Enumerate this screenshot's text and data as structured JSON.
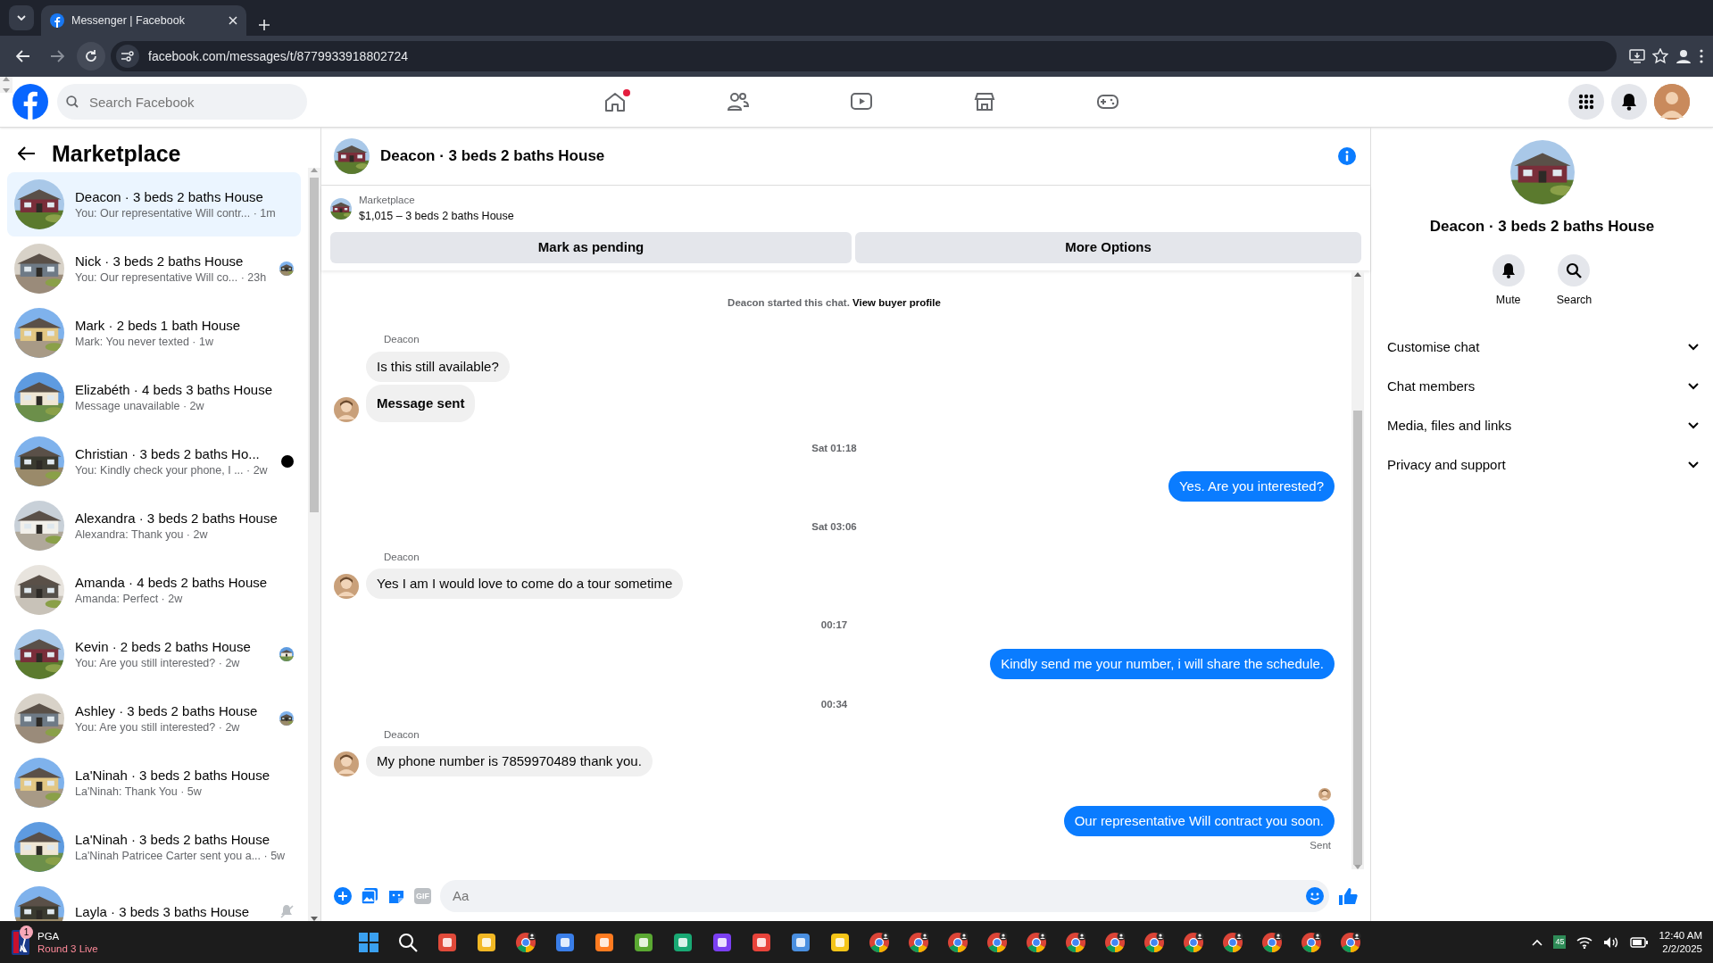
{
  "browser": {
    "tab_title": "Messenger | Facebook",
    "url": "facebook.com/messages/t/8779933918802724"
  },
  "header": {
    "search_placeholder": "Search Facebook",
    "nav": [
      {
        "kind": "home",
        "dot": true
      },
      {
        "kind": "friends",
        "dot": false
      },
      {
        "kind": "video",
        "dot": false
      },
      {
        "kind": "marketplace",
        "dot": false
      },
      {
        "kind": "gaming",
        "dot": false
      }
    ]
  },
  "sidebar": {
    "title": "Marketplace",
    "conversations": [
      {
        "title": "Deacon · 3 beds 2 baths House",
        "preview": "You: Our representative Will contr...",
        "time": "· 1m",
        "selected": true
      },
      {
        "title": "Nick · 3 beds 2 baths House",
        "preview": "You: Our representative Will co...",
        "time": "· 23h",
        "selected": false,
        "badge": {
          "kind": "read_avatar"
        }
      },
      {
        "title": "Mark · 2 beds 1 bath House",
        "preview": "Mark: You never texted",
        "time": "· 1w",
        "selected": false
      },
      {
        "title": "Elizabéth · 4 beds 3 baths House",
        "preview": "Message unavailable",
        "time": "· 2w",
        "selected": false
      },
      {
        "title": "Christian · 3 beds 2 baths Ho...",
        "preview": "You: Kindly check your phone, I ...",
        "time": "· 2w",
        "selected": false,
        "badge": {
          "kind": "dot"
        }
      },
      {
        "title": "Alexandra · 3 beds 2 baths House",
        "preview": "Alexandra: Thank you",
        "time": "· 2w",
        "selected": false
      },
      {
        "title": "Amanda · 4 beds 2 baths House",
        "preview": "Amanda: Perfect",
        "time": "· 2w",
        "selected": false
      },
      {
        "title": "Kevin · 2 beds 2 baths House",
        "preview": "You: Are you still interested?",
        "time": "· 2w",
        "selected": false,
        "badge": {
          "kind": "read_avatar"
        }
      },
      {
        "title": "Ashley · 3 beds 2 baths House",
        "preview": "You: Are you still interested?",
        "time": "· 2w",
        "selected": false,
        "badge": {
          "kind": "read_avatar"
        }
      },
      {
        "title": "La'Ninah · 3 beds 2 baths House",
        "preview": "La'Ninah: Thank You",
        "time": "· 5w",
        "selected": false
      },
      {
        "title": "La'Ninah · 3 beds 2 baths House",
        "preview": "La'Ninah Patricee Carter sent you a...",
        "time": "· 5w",
        "selected": false
      },
      {
        "title": "Layla · 3 beds 3 baths House",
        "selected": false,
        "badge": {
          "kind": "muted"
        }
      }
    ]
  },
  "chat": {
    "title": "Deacon · 3 beds 2 baths House",
    "listing_label": "Marketplace",
    "listing": "$1,015 – 3 beds 2 baths House",
    "actions": [
      "Mark as pending",
      "More Options"
    ],
    "messages": [
      {
        "kind": "system",
        "text": "Deacon started this chat.",
        "link": "View buyer profile"
      },
      {
        "kind": "sender",
        "text": "Deacon"
      },
      {
        "kind": "incoming",
        "text": "Is this still available?",
        "bold": false
      },
      {
        "kind": "incoming",
        "text": "Message sent",
        "bold": true
      },
      {
        "kind": "timestamp",
        "text": "Sat 01:18"
      },
      {
        "kind": "outgoing",
        "text": "Yes. Are you interested?"
      },
      {
        "kind": "timestamp",
        "text": "Sat 03:06"
      },
      {
        "kind": "sender",
        "text": "Deacon"
      },
      {
        "kind": "incoming",
        "text": "Yes I am I would love to come do a tour sometime",
        "bold": false
      },
      {
        "kind": "timestamp",
        "text": "00:17"
      },
      {
        "kind": "outgoing",
        "text": "Kindly send me your number, i will share the schedule."
      },
      {
        "kind": "timestamp",
        "text": "00:34"
      },
      {
        "kind": "sender",
        "text": "Deacon"
      },
      {
        "kind": "incoming",
        "text": "My phone number is 7859970489 thank you.",
        "bold": false
      },
      {
        "kind": "seen"
      },
      {
        "kind": "outgoing",
        "text": "Our representative Will contract you soon."
      },
      {
        "kind": "status",
        "text": "Sent"
      }
    ],
    "composer": {
      "placeholder": "Aa",
      "gif_label": "GIF"
    }
  },
  "info": {
    "title": "Deacon · 3 beds 2 baths House",
    "actions": [
      {
        "kind": "mute",
        "label": "Mute"
      },
      {
        "kind": "search",
        "label": "Search"
      }
    ],
    "sections": [
      "Customise chat",
      "Chat members",
      "Media, files and links",
      "Privacy and support"
    ]
  },
  "taskbar": {
    "widget": {
      "title": "PGA",
      "subtitle": "Round 3 Live",
      "badge": "1"
    },
    "apps": [
      {
        "kind": "windows"
      },
      {
        "kind": "search"
      },
      {
        "kind": "tile",
        "color": "#e04a3a"
      },
      {
        "kind": "tile",
        "color": "#f2b824"
      },
      {
        "kind": "chrome"
      },
      {
        "kind": "tile",
        "color": "#3a7ee8"
      },
      {
        "kind": "tile",
        "color": "#ff7b20"
      },
      {
        "kind": "tile",
        "color": "#5aa832"
      },
      {
        "kind": "tile",
        "color": "#19a974"
      },
      {
        "kind": "tile",
        "color": "#7b3ff2"
      },
      {
        "kind": "tile",
        "color": "#e8433a"
      },
      {
        "kind": "tile",
        "color": "#4a8fe0"
      },
      {
        "kind": "tile",
        "color": "#f5c518"
      },
      {
        "kind": "chrome"
      },
      {
        "kind": "chrome"
      },
      {
        "kind": "chrome"
      },
      {
        "kind": "chrome"
      },
      {
        "kind": "chrome"
      },
      {
        "kind": "chrome"
      },
      {
        "kind": "chrome"
      },
      {
        "kind": "chrome"
      },
      {
        "kind": "chrome"
      },
      {
        "kind": "chrome"
      },
      {
        "kind": "chrome"
      },
      {
        "kind": "chrome"
      },
      {
        "kind": "chrome"
      }
    ],
    "tray_badge": "45",
    "time": "12:40 AM",
    "date": "2/2/2025"
  }
}
